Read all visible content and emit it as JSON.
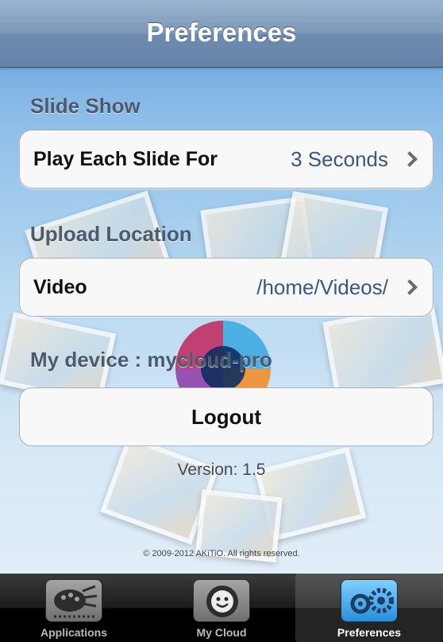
{
  "nav": {
    "title": "Preferences"
  },
  "sections": {
    "slideshow": {
      "header": "Slide Show",
      "row_label": "Play Each Slide For",
      "row_value": "3 Seconds"
    },
    "upload": {
      "header": "Upload Location",
      "row_label": "Video",
      "row_value": "/home/Videos/"
    },
    "device": {
      "text": "My device : mycloud-pro"
    }
  },
  "logout_label": "Logout",
  "version": "Version: 1.5",
  "copyright": "© 2009-2012 AKiTiO. All rights reserved.",
  "tabbar": {
    "tabs": [
      {
        "label": "Applications",
        "icon": "palette-icon",
        "selected": false
      },
      {
        "label": "My Cloud",
        "icon": "smiley-cloud-icon",
        "selected": false
      },
      {
        "label": "Preferences",
        "icon": "gears-icon",
        "selected": true
      }
    ]
  },
  "colors": {
    "accent_value": "#3a5582",
    "tab_selected": "#2a8edb"
  }
}
